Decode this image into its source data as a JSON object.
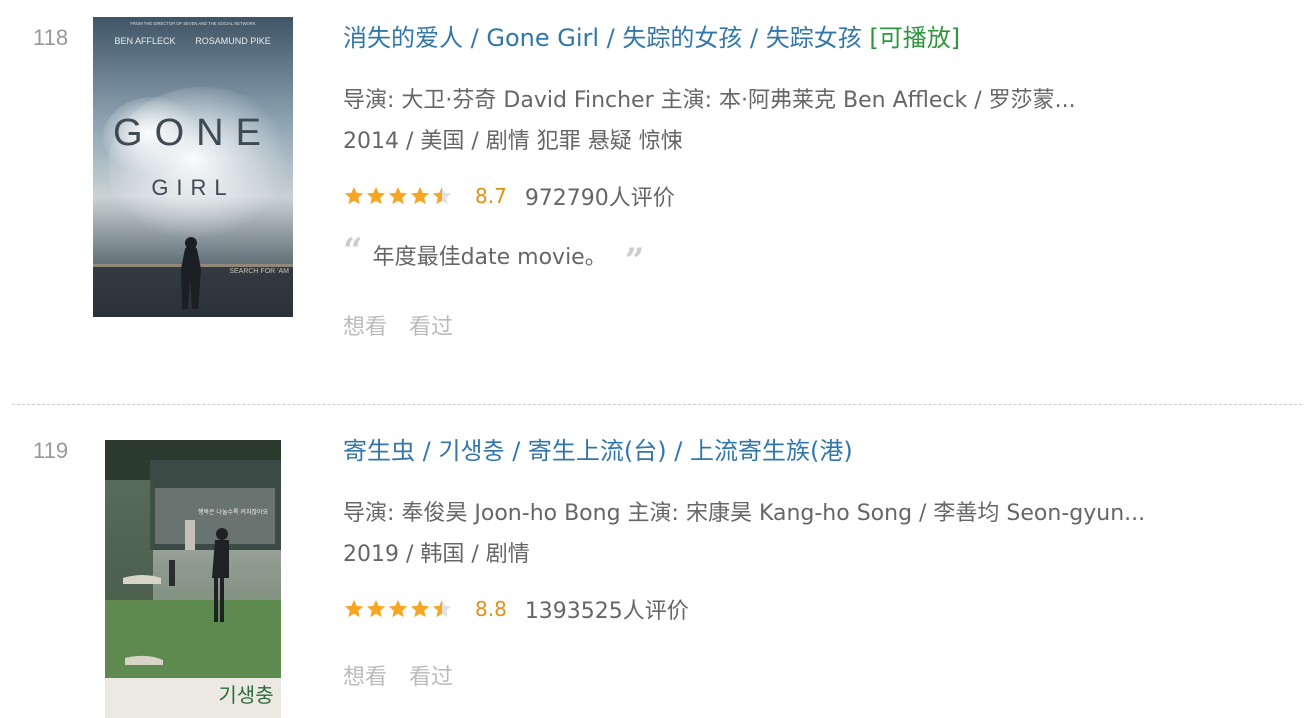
{
  "colors": {
    "link": "#3377aa",
    "playable": "#2e963d",
    "score": "#e09015",
    "star_fill": "#f5a623",
    "star_empty": "#e0e0e0"
  },
  "movies": [
    {
      "rank": "118",
      "title": "消失的爱人",
      "alt_titles": " / Gone Girl  / 失踪的女孩 / 失踪女孩",
      "playable": "[可播放]",
      "director_cast": "导演: 大卫·芬奇 David Fincher   主演: 本·阿弗莱克 Ben Affleck / 罗莎蒙...",
      "year_genre": "2014 / 美国 / 剧情 犯罪 悬疑 惊悚",
      "rating_stars": 4.5,
      "score": "8.7",
      "votes": "972790人评价",
      "quote": "年度最佳date movie。",
      "poster_text": {
        "top_small": "FROM THE DIRECTOR OF SEVEN AND THE SOCIAL NETWORK",
        "actor1": "BEN AFFLECK",
        "actor2": "ROSAMUND PIKE",
        "title1": "GONE",
        "title2": "GIRL",
        "tagline": "SEARCH FOR 'AM"
      },
      "want_label": "想看",
      "seen_label": "看过"
    },
    {
      "rank": "119",
      "title": "寄生虫",
      "alt_titles": "  / 기생충  / 寄生上流(台) / 上流寄生族(港)",
      "director_cast": "导演: 奉俊昊 Joon-ho Bong   主演: 宋康昊 Kang-ho Song / 李善均 Seon-gyun...",
      "year_genre": "2019 / 韩国 / 剧情",
      "rating_stars": 4.5,
      "score": "8.8",
      "votes": "1393525人评价",
      "poster_text": {
        "korean_title": "기생충",
        "slogan": "행복은 나눌수록 커지잖아요"
      },
      "want_label": "想看",
      "seen_label": "看过"
    }
  ]
}
